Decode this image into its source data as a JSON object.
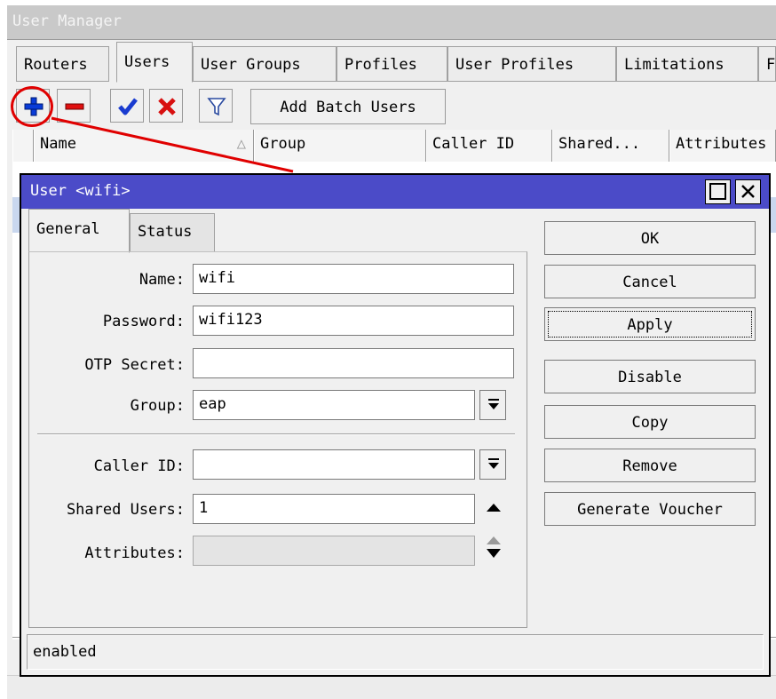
{
  "window": {
    "title": "User Manager"
  },
  "main_tabs": [
    {
      "label": "Routers"
    },
    {
      "label": "Users"
    },
    {
      "label": "User Groups"
    },
    {
      "label": "Profiles"
    },
    {
      "label": "User Profiles"
    },
    {
      "label": "Limitations"
    },
    {
      "label": "F"
    }
  ],
  "toolbar": {
    "add_icon": "plus-icon",
    "remove_icon": "minus-icon",
    "enable_icon": "checkmark-icon",
    "disable_icon": "x-icon",
    "filter_icon": "filter-icon",
    "batch_label": "Add Batch Users"
  },
  "table": {
    "columns": [
      "Name",
      "Group",
      "Caller ID",
      "Shared...",
      "Attributes"
    ]
  },
  "dialog": {
    "title": "User <wifi>",
    "tabs": [
      "General",
      "Status"
    ],
    "fields": {
      "name_label": "Name:",
      "name_value": "wifi",
      "password_label": "Password:",
      "password_value": "wifi123",
      "otp_label": "OTP Secret:",
      "otp_value": "",
      "group_label": "Group:",
      "group_value": "eap",
      "caller_label": "Caller ID:",
      "caller_value": "",
      "shared_label": "Shared Users:",
      "shared_value": "1",
      "attributes_label": "Attributes:",
      "attributes_value": ""
    },
    "buttons": [
      "OK",
      "Cancel",
      "Apply",
      "Disable",
      "Copy",
      "Remove",
      "Generate Voucher"
    ],
    "status": "enabled"
  },
  "colors": {
    "dialog_title_bg": "#4b4bc8",
    "annotation": "#e00000",
    "add_icon": "#0a3cd8",
    "remove_icon": "#e01010",
    "check_icon": "#1a3cd0",
    "selected_row": "#c9d7ee"
  }
}
